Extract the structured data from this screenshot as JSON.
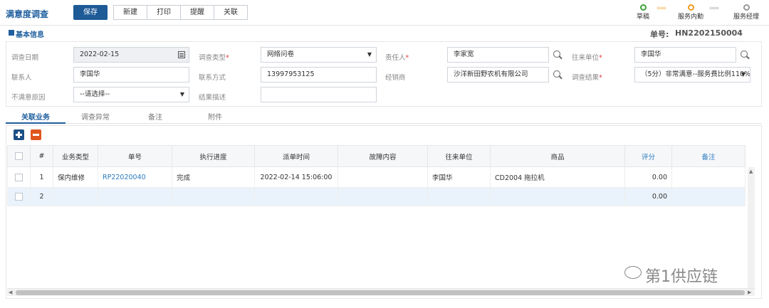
{
  "header": {
    "title": "满意度调查",
    "buttons": {
      "save": "保存",
      "new": "新建",
      "print": "打印",
      "remind": "提醒",
      "link": "关联"
    },
    "workflow": {
      "step1": "草稿",
      "step2": "服务内勤",
      "step3": "服务经理",
      "arrows": "›››››"
    }
  },
  "basic_info": {
    "section_title": "基本信息",
    "docno_label": "单号:",
    "docno_value": "HN2202150004",
    "fields": {
      "survey_date_label": "调查日期",
      "survey_date": "2022-02-15",
      "survey_type_label": "调查类型",
      "survey_type": "网络问卷",
      "owner_label": "责任人",
      "owner": "李家宽",
      "partner_label": "往来单位",
      "partner": "李国华",
      "contact_label": "联系人",
      "contact": "李国华",
      "contact_method_label": "联系方式",
      "contact_method": "13997953125",
      "dealer_label": "经销商",
      "dealer": "沙洋新田野农机有限公司",
      "result_label": "调查结果",
      "result": "（5分）非常满意--服务费比例110%",
      "dissatisfied_reason_label": "不满意原因",
      "dissatisfied_reason": "--请选择--",
      "result_desc_label": "结果描述",
      "result_desc": ""
    },
    "required_mark": "*"
  },
  "tabs": [
    "关联业务",
    "调查异常",
    "备注",
    "附件"
  ],
  "grid": {
    "columns": [
      "#",
      "业务类型",
      "单号",
      "执行进度",
      "派单时间",
      "故障内容",
      "往来单位",
      "商品",
      "评分",
      "备注"
    ],
    "rows": [
      {
        "num": "1",
        "biz_type": "保内维修",
        "order_no": "RP22020040",
        "progress": "完成",
        "dispatch_time": "2022-02-14 15:06:00",
        "fault": "",
        "partner": "李国华",
        "product": "CD2004 拖拉机",
        "score": "0.00",
        "note": ""
      },
      {
        "num": "2",
        "biz_type": "",
        "order_no": "",
        "progress": "",
        "dispatch_time": "",
        "fault": "",
        "partner": "",
        "product": "",
        "score": "0.00",
        "note": ""
      }
    ]
  },
  "watermark": "第1供应链",
  "colors": {
    "accent": "#1f5f9f",
    "primary_button": "#1d5a96",
    "add": "#1d4f86",
    "delete": "#e0561f",
    "required": "#e03c3c",
    "workflow_step1": "#3aa33a",
    "workflow_step2": "#f39a1e",
    "workflow_step3": "#999999"
  }
}
